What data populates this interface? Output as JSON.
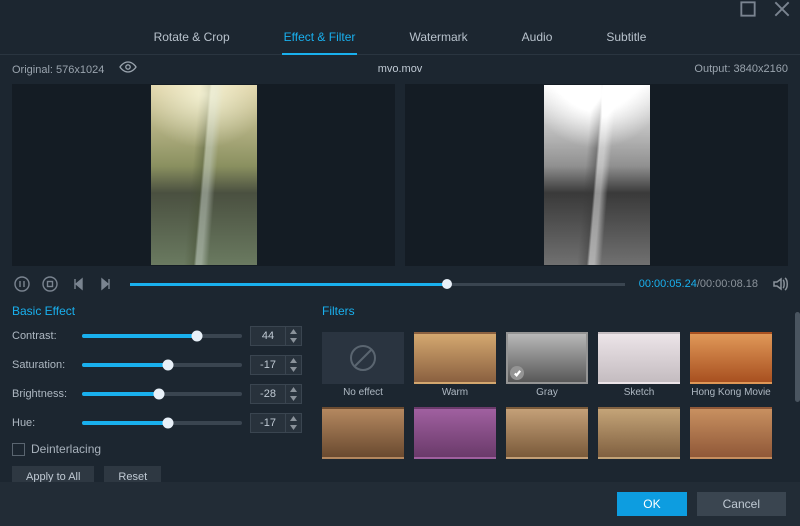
{
  "titlebar": {
    "maximize": "maximize",
    "close": "close"
  },
  "tabs": [
    {
      "label": "Rotate & Crop"
    },
    {
      "label": "Effect & Filter",
      "active": true
    },
    {
      "label": "Watermark"
    },
    {
      "label": "Audio"
    },
    {
      "label": "Subtitle"
    }
  ],
  "filebar": {
    "original_label": "Original: 576x1024",
    "filename": "mvo.mov",
    "output_label": "Output: 3840x2160"
  },
  "timeline": {
    "current": "00:00:05.24",
    "total": "/00:00:08.18",
    "progress_pct": 64
  },
  "basic_effect": {
    "title": "Basic Effect",
    "rows": [
      {
        "label": "Contrast:",
        "value": "44",
        "pct": 72
      },
      {
        "label": "Saturation:",
        "value": "-17",
        "pct": 54
      },
      {
        "label": "Brightness:",
        "value": "-28",
        "pct": 48
      },
      {
        "label": "Hue:",
        "value": "-17",
        "pct": 54
      }
    ],
    "deinterlacing_label": "Deinterlacing",
    "apply_all_label": "Apply to All",
    "reset_label": "Reset"
  },
  "filters": {
    "title": "Filters",
    "items": [
      {
        "label": "No effect",
        "kind": "noeffect"
      },
      {
        "label": "Warm",
        "kind": "warm"
      },
      {
        "label": "Gray",
        "kind": "gray",
        "selected": true
      },
      {
        "label": "Sketch",
        "kind": "sketch"
      },
      {
        "label": "Hong Kong Movie",
        "kind": "hk"
      },
      {
        "label": "",
        "kind": "r2a"
      },
      {
        "label": "",
        "kind": "r2b"
      },
      {
        "label": "",
        "kind": "r2c"
      },
      {
        "label": "",
        "kind": "r2d"
      },
      {
        "label": "",
        "kind": "r2e"
      }
    ]
  },
  "footer": {
    "ok": "OK",
    "cancel": "Cancel"
  }
}
